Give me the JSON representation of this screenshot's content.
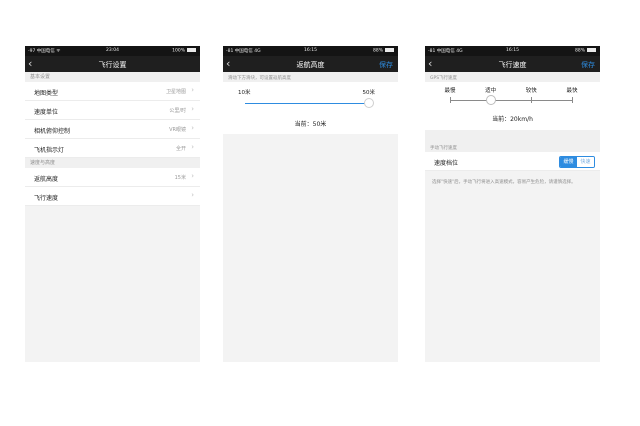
{
  "screen1": {
    "status": {
      "carrier": "-97 中国电信 ᯤ",
      "time": "23:04",
      "battery": "100%"
    },
    "nav": {
      "back": "‹",
      "title": "飞行设置"
    },
    "section_basic": "基本设置",
    "rows_basic": [
      {
        "label": "地图类型",
        "value": "卫星地图"
      },
      {
        "label": "速度单位",
        "value": "公里/时"
      },
      {
        "label": "相机俯仰控制",
        "value": "VR眼镜"
      },
      {
        "label": "飞机指示灯",
        "value": "全开"
      }
    ],
    "section_speed": "速度与高度",
    "rows_speed": [
      {
        "label": "返航高度",
        "value": "15米"
      },
      {
        "label": "飞行速度",
        "value": ""
      }
    ],
    "chevron": "›"
  },
  "screen2": {
    "status": {
      "carrier": "-81 中国电信  4G",
      "time": "16:15",
      "battery": "88%"
    },
    "nav": {
      "back": "‹",
      "title": "返航高度",
      "save": "保存"
    },
    "hint": "滑动下方滑块，可设置返航高度",
    "slider": {
      "min": "10米",
      "max": "50米",
      "fraction": 1.0
    },
    "current": "当前：50米"
  },
  "screen3": {
    "status": {
      "carrier": "-81 中国电信  4G",
      "time": "16:15",
      "battery": "88%"
    },
    "nav": {
      "back": "‹",
      "title": "飞行速度",
      "save": "保存"
    },
    "gps_header": "GPS飞行速度",
    "speed_levels": [
      "最慢",
      "适中",
      "较快",
      "最快"
    ],
    "selected_index": 1,
    "current": "当前：20km/h",
    "manual_header": "手动飞行速度",
    "gear_label": "速度档位",
    "gear_options": [
      "缓慢",
      "快速"
    ],
    "note": "选择\"快速\"后，手动飞行将进入高速模式，容易产生危险，请谨慎选择。"
  },
  "colors": {
    "accent": "#2e8ce0",
    "nav_bg": "#1f1f1f",
    "status_bg": "#141414",
    "page_bg": "#f3f3f3"
  }
}
